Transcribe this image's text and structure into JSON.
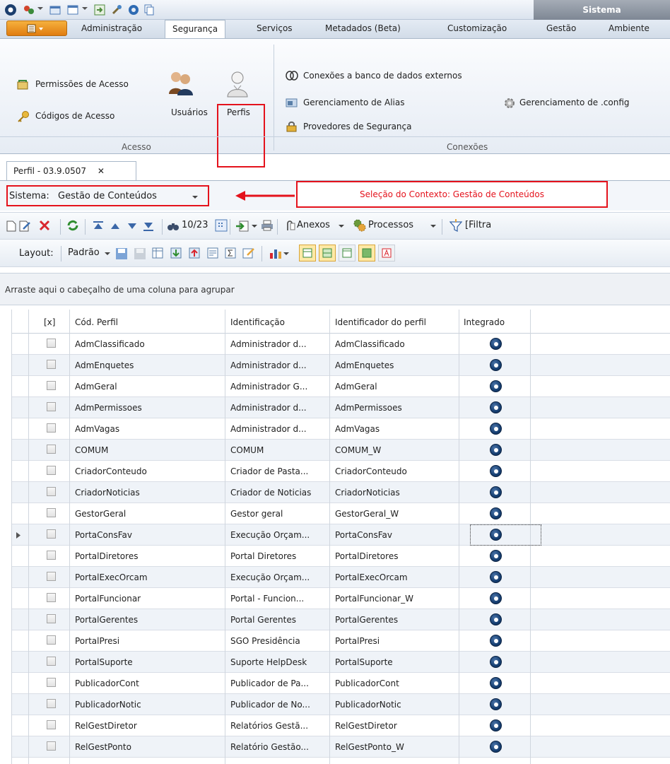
{
  "titlebar": {
    "system_tab": "Sistema"
  },
  "ribbon_tabs": [
    "Administração",
    "Segurança",
    "Serviços",
    "Metadados (Beta)",
    "Customização",
    "Gestão",
    "Ambiente"
  ],
  "ribbon": {
    "acesso": {
      "permissoes": "Permissões de Acesso",
      "codigos": "Códigos de Acesso",
      "usuarios": "Usuários",
      "perfis": "Perfis",
      "group_label": "Acesso"
    },
    "conexoes": {
      "externos": "Conexões a banco de dados externos",
      "alias": "Gerenciamento de Alias",
      "provedores": "Provedores de Segurança",
      "config": "Gerenciamento de .config",
      "group_label": "Conexões"
    }
  },
  "doc_tab": {
    "title": "Perfil - 03.9.0507",
    "close": "✕"
  },
  "context": {
    "label": "Sistema:",
    "value": "Gestão de Conteúdos"
  },
  "annotation": {
    "text": "Seleção do Contexto: Gestão de Conteúdos",
    "color": "#e4121c"
  },
  "toolbar": {
    "counter": "10/23",
    "anexos": "Anexos",
    "processos": "Processos",
    "filtro": "[Filtra"
  },
  "layout_bar": {
    "label": "Layout:",
    "preset": "Padrão"
  },
  "group_hint": "Arraste aqui o cabeçalho de uma coluna para agrupar",
  "grid": {
    "columns": [
      "[x]",
      "Cód. Perfil",
      "Identificação",
      "Identificador do perfil",
      "Integrado"
    ],
    "rows": [
      {
        "cod": "AdmClassificado",
        "ident": "Administrador d...",
        "idperfil": "AdmClassificado"
      },
      {
        "cod": "AdmEnquetes",
        "ident": "Administrador d...",
        "idperfil": "AdmEnquetes"
      },
      {
        "cod": "AdmGeral",
        "ident": "Administrador G...",
        "idperfil": "AdmGeral"
      },
      {
        "cod": "AdmPermissoes",
        "ident": "Administrador d...",
        "idperfil": "AdmPermissoes"
      },
      {
        "cod": "AdmVagas",
        "ident": "Administrador d...",
        "idperfil": "AdmVagas"
      },
      {
        "cod": "COMUM",
        "ident": "COMUM",
        "idperfil": "COMUM_W"
      },
      {
        "cod": "CriadorConteudo",
        "ident": "Criador de Pasta...",
        "idperfil": "CriadorConteudo"
      },
      {
        "cod": "CriadorNoticias",
        "ident": "Criador de Noticias",
        "idperfil": "CriadorNoticias"
      },
      {
        "cod": "GestorGeral",
        "ident": "Gestor geral",
        "idperfil": "GestorGeral_W"
      },
      {
        "cod": "PortaConsFav",
        "ident": "Execução Orçam...",
        "idperfil": "PortaConsFav"
      },
      {
        "cod": "PortalDiretores",
        "ident": "Portal Diretores",
        "idperfil": "PortalDiretores"
      },
      {
        "cod": "PortalExecOrcam",
        "ident": "Execução Orçam...",
        "idperfil": "PortalExecOrcam"
      },
      {
        "cod": "PortalFuncionar",
        "ident": "Portal - Funcion...",
        "idperfil": "PortalFuncionar_W"
      },
      {
        "cod": "PortalGerentes",
        "ident": "Portal Gerentes",
        "idperfil": "PortalGerentes"
      },
      {
        "cod": "PortalPresi",
        "ident": "SGO Presidência",
        "idperfil": "PortalPresi"
      },
      {
        "cod": "PortalSuporte",
        "ident": "Suporte HelpDesk",
        "idperfil": "PortalSuporte"
      },
      {
        "cod": "PublicadorCont",
        "ident": "Publicador de Pa...",
        "idperfil": "PublicadorCont"
      },
      {
        "cod": "PublicadorNotic",
        "ident": "Publicador de No...",
        "idperfil": "PublicadorNotic"
      },
      {
        "cod": "RelGestDiretor",
        "ident": "Relatórios Gestã...",
        "idperfil": "RelGestDiretor"
      },
      {
        "cod": "RelGestPonto",
        "ident": "Relatório Gestão...",
        "idperfil": "RelGestPonto_W"
      }
    ],
    "current_row_index": 9
  }
}
